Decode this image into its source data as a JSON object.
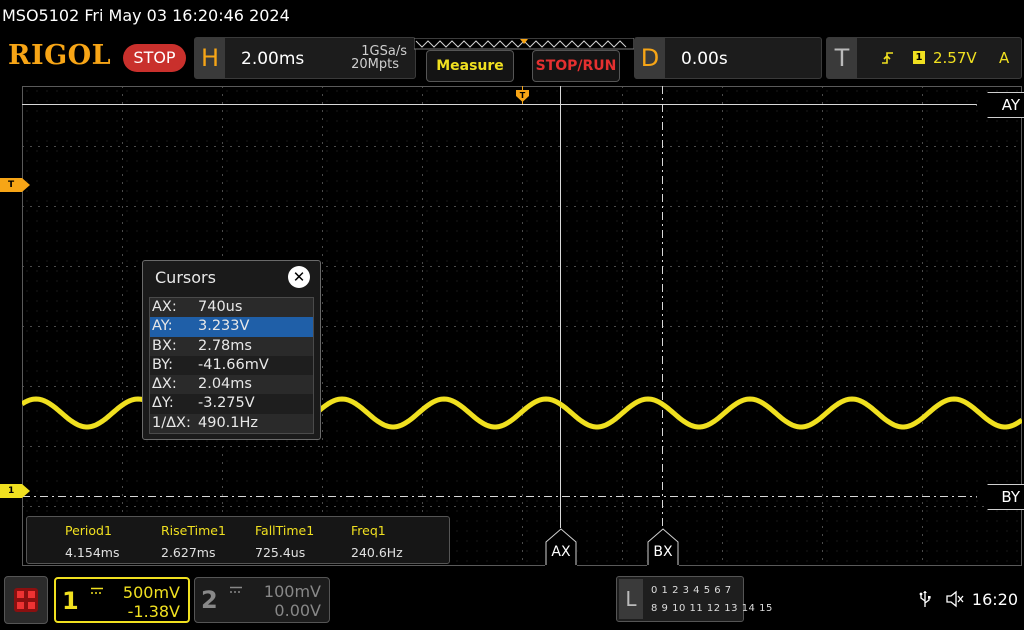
{
  "status_line": "MSO5102  Fri May 03 16:20:46 2024",
  "logo": "RIGOL",
  "run_state": "STOP",
  "horizontal": {
    "letter": "H",
    "timebase": "2.00ms",
    "sample_rate": "1GSa/s",
    "memory_depth": "20Mpts"
  },
  "buttons": {
    "measure": "Measure",
    "stop_run": "STOP/RUN"
  },
  "delay": {
    "letter": "D",
    "value": "0.00s"
  },
  "trigger": {
    "letter": "T",
    "level": "2.57V",
    "mode": "A",
    "edge_icon": "rising-edge-icon",
    "source": "1"
  },
  "markers": {
    "trigger_level": "T",
    "channel1_ground": "1"
  },
  "cursor_labels": {
    "ay": "AY",
    "by": "BY",
    "ax": "AX",
    "bx": "BX"
  },
  "cursors_panel": {
    "title": "Cursors",
    "close_icon": "close-icon",
    "rows": [
      {
        "key": "AX:",
        "value": "740us"
      },
      {
        "key": "AY:",
        "value": "3.233V"
      },
      {
        "key": "BX:",
        "value": "2.78ms"
      },
      {
        "key": "BY:",
        "value": "-41.66mV"
      },
      {
        "key": "ΔX:",
        "value": "2.04ms"
      },
      {
        "key": "ΔY:",
        "value": "-3.275V"
      },
      {
        "key": "1/ΔX:",
        "value": "490.1Hz"
      }
    ]
  },
  "measurements": [
    {
      "name": "Period1",
      "value": "4.154ms"
    },
    {
      "name": "RiseTime1",
      "value": "2.627ms"
    },
    {
      "name": "FallTime1",
      "value": "725.4us"
    },
    {
      "name": "Freq1",
      "value": "240.6Hz"
    }
  ],
  "channels": [
    {
      "num": "1",
      "scale": "500mV",
      "offset": "-1.38V",
      "coupling_icon": "dc-coupling-icon",
      "color": "#f0e020"
    },
    {
      "num": "2",
      "scale": "100mV",
      "offset": "0.00V",
      "coupling_icon": "dc-coupling-icon",
      "color": "#777777"
    }
  ],
  "logic_analyzer": {
    "letter": "L",
    "bits_row1": "0 1 2 3  4 5 6 7",
    "bits_row2": "8 9 10 11 12 13 14 15"
  },
  "tray": {
    "usb_icon": "usb-icon",
    "mute_icon": "speaker-muted-icon",
    "time": "16:20"
  },
  "colors": {
    "accent": "#f7a516",
    "trace": "#f0e020",
    "stop": "#c9302c",
    "selection": "#1f5fa8"
  }
}
